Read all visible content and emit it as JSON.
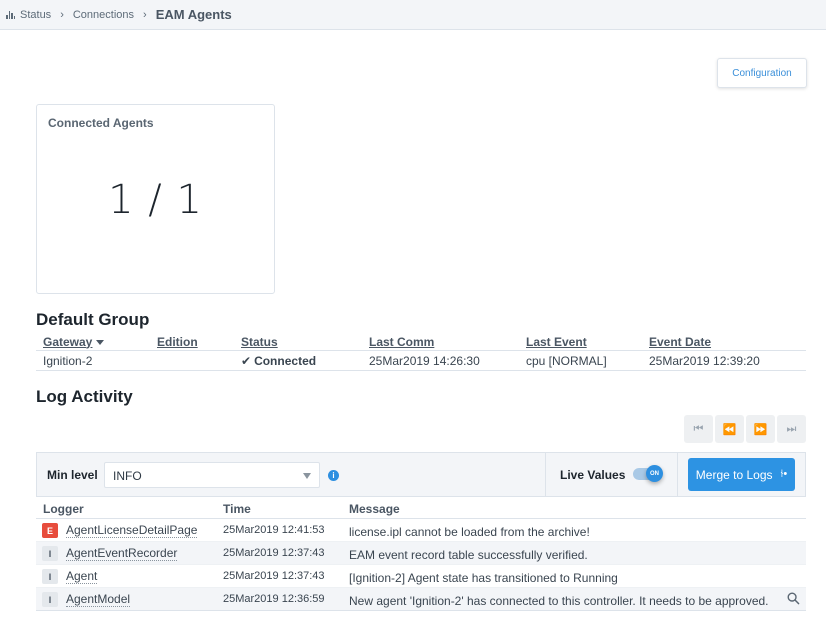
{
  "breadcrumb": {
    "items": [
      "Status",
      "Connections"
    ],
    "current": "EAM Agents",
    "icon": "bar-chart-icon"
  },
  "toolbar": {
    "configuration_label": "Configuration"
  },
  "connected_agents": {
    "title": "Connected Agents",
    "value": "1 / 1"
  },
  "default_group": {
    "title": "Default Group",
    "columns": [
      "Gateway",
      "Edition",
      "Status",
      "Last Comm",
      "Last Event",
      "Event Date"
    ],
    "sort_column": "Gateway",
    "rows": [
      {
        "gateway": "Ignition-2",
        "edition": "",
        "status": "Connected",
        "last_comm": "25Mar2019 14:26:30",
        "last_event": "cpu [NORMAL]",
        "event_date": "25Mar2019 12:39:20"
      }
    ]
  },
  "log_activity": {
    "title": "Log Activity",
    "pager": [
      "first-page-icon",
      "previous-page-icon",
      "next-page-icon",
      "last-page-icon"
    ],
    "min_level_label": "Min level",
    "min_level_value": "INFO",
    "live_values_label": "Live Values",
    "live_values_state": "ON",
    "merge_label": "Merge to Logs",
    "columns": [
      "Logger",
      "Time",
      "Message"
    ],
    "rows": [
      {
        "level": "E",
        "logger": "AgentLicenseDetailPage",
        "time": "25Mar2019 12:41:53",
        "message": "license.ipl cannot be loaded from the archive!"
      },
      {
        "level": "I",
        "logger": "AgentEventRecorder",
        "time": "25Mar2019 12:37:43",
        "message": "EAM event record table successfully verified."
      },
      {
        "level": "I",
        "logger": "Agent",
        "time": "25Mar2019 12:37:43",
        "message": "[Ignition-2] Agent state has transitioned to Running"
      },
      {
        "level": "I",
        "logger": "AgentModel",
        "time": "25Mar2019 12:36:59",
        "message": "New agent 'Ignition-2' has connected to this controller. It needs to be approved."
      }
    ]
  },
  "colors": {
    "accent": "#2d93e3",
    "success": "#33b86a",
    "error": "#e74c3c"
  }
}
